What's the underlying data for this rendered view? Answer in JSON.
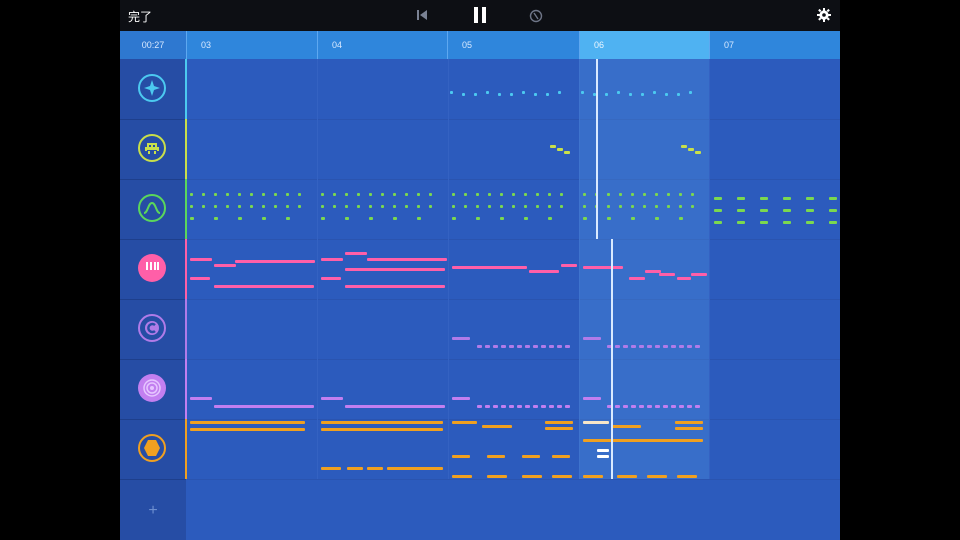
{
  "topbar": {
    "done_label": "完了",
    "icons": [
      "skip-back-icon",
      "pause-icon",
      "metronome-icon",
      "gear-icon"
    ]
  },
  "ruler": {
    "time": "00:27",
    "bars": [
      "03",
      "04",
      "05",
      "06",
      "07"
    ],
    "active_bar": "06"
  },
  "tracks": [
    {
      "name": "sparkle-icon",
      "color": "#4cc9f0"
    },
    {
      "name": "invader-icon",
      "color": "#c8e04a"
    },
    {
      "name": "wave-icon",
      "color": "#5bd65b"
    },
    {
      "name": "keyboard-icon",
      "color": "#ff5fa8"
    },
    {
      "name": "c-logo-icon",
      "color": "#b07be8"
    },
    {
      "name": "target-icon",
      "color": "#c27ff0"
    },
    {
      "name": "hexagon-icon",
      "color": "#f0a020"
    }
  ],
  "add_track_label": "+",
  "colors": {
    "background": "#2c5bbd",
    "ruler": "#2f86dc",
    "ruler_active": "#4fb2f2",
    "topbar": "#0d0f14"
  }
}
